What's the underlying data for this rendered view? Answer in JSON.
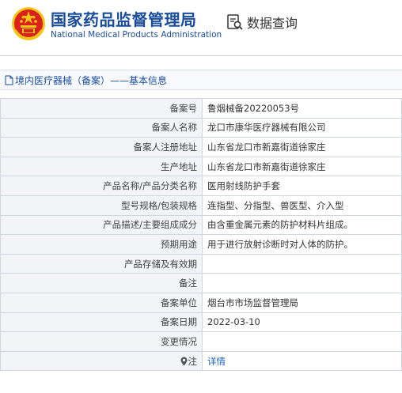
{
  "header": {
    "org_cn": "国家药品监督管理局",
    "org_en": "National Medical Products Administration",
    "query_label": "数据查询",
    "colors": {
      "brand": "#1a4c9c",
      "emblem_red": "#d9221c",
      "emblem_gold": "#f5c518"
    }
  },
  "breadcrumb": {
    "text": "境内医疗器械（备案）——基本信息"
  },
  "details": [
    {
      "label": "备案号",
      "value": "鲁烟械备20220053号"
    },
    {
      "label": "备案人名称",
      "value": "龙口市康华医疗器械有限公司"
    },
    {
      "label": "备案人注册地址",
      "value": "山东省龙口市新嘉街道徐家庄"
    },
    {
      "label": "生产地址",
      "value": "山东省龙口市新嘉街道徐家庄"
    },
    {
      "label": "产品名称/产品分类名称",
      "value": "医用射线防护手套"
    },
    {
      "label": "型号规格/包装规格",
      "value": "连指型、分指型、兽医型、介入型"
    },
    {
      "label": "产品描述/主要组成成分",
      "value": "由含重金属元素的防护材料片组成。"
    },
    {
      "label": "预期用途",
      "value": "用于进行放射诊断时对人体的防护。"
    },
    {
      "label": "产品存储及有效期",
      "value": ""
    },
    {
      "label": "备注",
      "value": ""
    },
    {
      "label": "备案单位",
      "value": "烟台市市场监督管理局"
    },
    {
      "label": "备案日期",
      "value": "2022-03-10"
    },
    {
      "label": "变更情况",
      "value": ""
    },
    {
      "label": "注",
      "value": "详情",
      "icon": "pin-icon"
    }
  ]
}
